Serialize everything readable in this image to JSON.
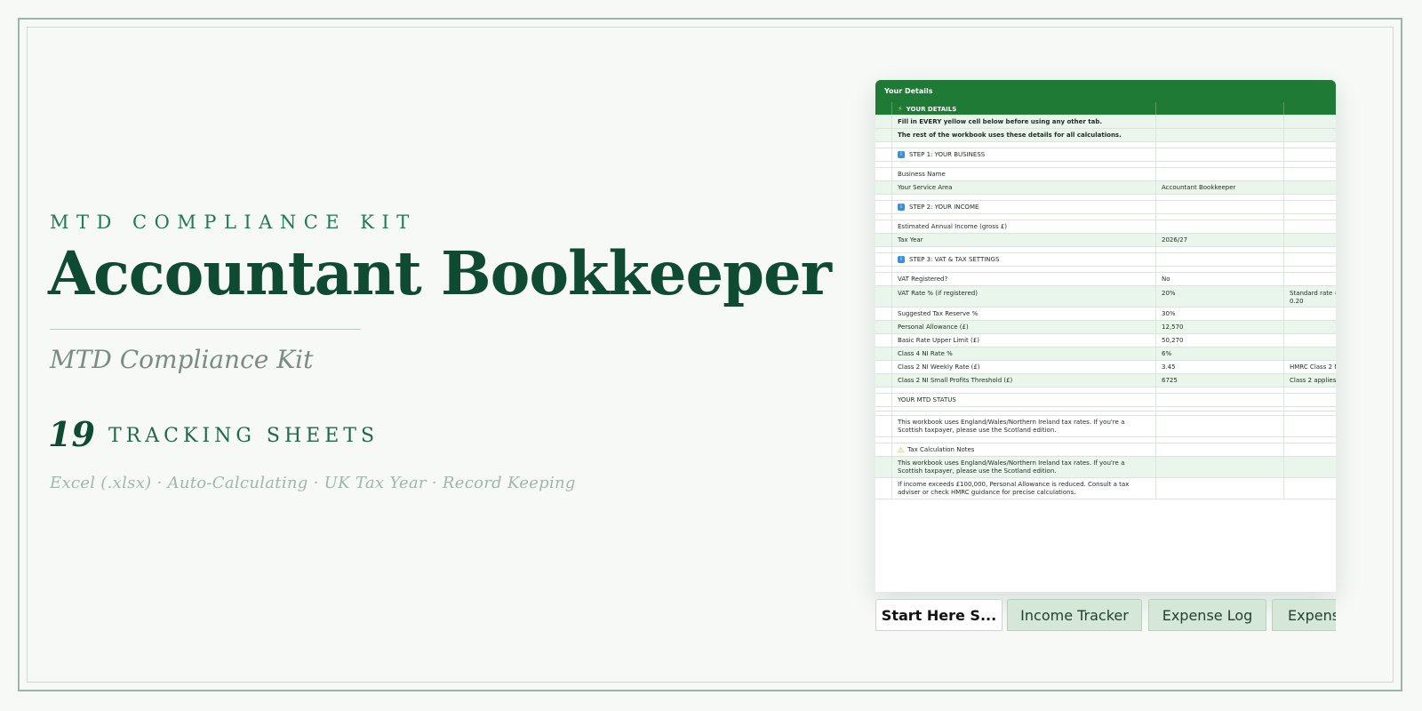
{
  "hero": {
    "kicker": "MTD COMPLIANCE KIT",
    "title": "Accountant Bookkeeper",
    "subtitle": "MTD Compliance Kit",
    "sheet_count": "19",
    "sheet_count_label": "TRACKING SHEETS",
    "features": "Excel (.xlsx) · Auto-Calculating · UK Tax Year · Record Keeping"
  },
  "sheet": {
    "header_title": "Your Details",
    "section_title": "YOUR DETAILS",
    "intro_1": "Fill in EVERY yellow cell below before using any other tab.",
    "intro_2": "The rest of the workbook uses these details for all calculations.",
    "step1": "STEP 1: YOUR BUSINESS",
    "business_name_label": "Business Name",
    "service_area_label": "Your Service Area",
    "service_area_value": "Accountant Bookkeeper",
    "step2": "STEP 2: YOUR INCOME",
    "annual_income_label": "Estimated Annual Income (gross £)",
    "tax_year_label": "Tax Year",
    "tax_year_value": "2026/27",
    "step3": "STEP 3: VAT & TAX SETTINGS",
    "vat_registered_label": "VAT Registered?",
    "vat_registered_value": "No",
    "vat_rate_label": "VAT Rate % (if registered)",
    "vat_rate_value": "20%",
    "vat_rate_note_1": "Standard rate =",
    "vat_rate_note_2": "0.20",
    "tax_reserve_label": "Suggested Tax Reserve %",
    "tax_reserve_value": "30%",
    "personal_allowance_label": "Personal Allowance (£)",
    "personal_allowance_value": "12,570",
    "basic_rate_label": "Basic Rate Upper Limit (£)",
    "basic_rate_value": "50,270",
    "class4_label": "Class 4 NI Rate %",
    "class4_value": "6%",
    "class2_weekly_label": "Class 2 NI Weekly Rate (£)",
    "class2_weekly_value": "3.45",
    "class2_weekly_note": "HMRC Class 2 N",
    "class2_threshold_label": "Class 2 NI Small Profits Threshold (£)",
    "class2_threshold_value": "6725",
    "class2_threshold_note": "Class 2 applies",
    "mtd_status": "YOUR MTD STATUS",
    "scotland_note": "This workbook uses England/Wales/Northern Ireland tax rates. If you're a Scottish taxpayer, please use the Scotland edition.",
    "tax_notes_title": "Tax Calculation Notes",
    "tax_notes_1": "This workbook uses England/Wales/Northern Ireland tax rates. If you're a Scottish taxpayer, please use the Scotland edition.",
    "tax_notes_2": "If income exceeds £100,000, Personal Allowance is reduced. Consult a tax adviser or check HMRC guidance for precise calculations."
  },
  "tabs": [
    {
      "label": "Start Here S..."
    },
    {
      "label": "Income Tracker"
    },
    {
      "label": "Expense Log"
    },
    {
      "label": "Expens"
    }
  ],
  "colors": {
    "brand_dark": "#0f4a33",
    "brand_accent": "#1f7a55",
    "sheet_header": "#1f7a35",
    "background": "#f6f9f6"
  }
}
